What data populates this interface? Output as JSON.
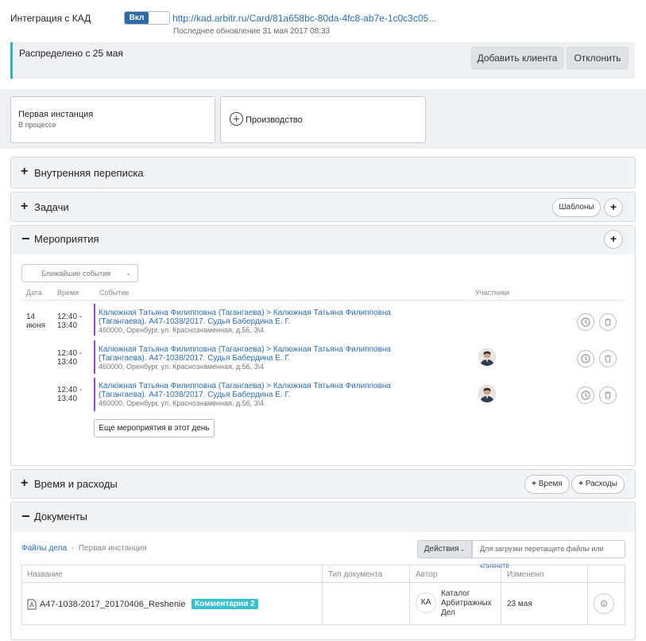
{
  "integration": {
    "title": "Интеграция с КАД",
    "toggle_label": "Вкл",
    "url": "http://kad.arbitr.ru/Card/81a658bc-80da-4fc8-ab7e-1c0c3c05...",
    "last_update": "Последнее обновление 31 мая 2017 08:33"
  },
  "distribution": {
    "text": "Распределено с 25 мая",
    "add_client_label": "Добавить клиента",
    "decline_label": "Отклонить"
  },
  "stages": {
    "first_title": "Первая инстанция",
    "first_status": "В процессе",
    "add_label": "Производство"
  },
  "sections": {
    "internal": "Внутренняя переписка",
    "tasks": "Задачи",
    "templates_label": "Шаблоны",
    "events": "Мероприятия",
    "time": "Время и расходы",
    "time_btn": "Время",
    "expenses_btn": "Расходы",
    "documents": "Документы"
  },
  "events": {
    "filter": "Ближайшие события",
    "headers": {
      "date": "Дата",
      "time": "Время",
      "event": "Событие",
      "participants": "Участники"
    },
    "date_day": "14",
    "date_month": "июня",
    "items": [
      {
        "time_start": "12:40 -",
        "time_end": "13:40",
        "line1": "Калюжная Татьяна Филипповна (Тагангаева) > Калюжная Татьяна Филипповна",
        "line2": "(Тагангаева). А47-1038/2017. Судья Бабердина Е. Г.",
        "address": "460000, Оренбург, ул. Краснознаменная, д.56, 3\\4"
      },
      {
        "time_start": "12:40 -",
        "time_end": "13:40",
        "line1": "Калюжная Татьяна Филипповна (Тагангаева) > Калюжная Татьяна Филипповна",
        "line2": "(Тагангаева). А47-1038/2017. Судья Бабердина Е. Г.",
        "address": "460000, Оренбург, ул. Краснознаменная, д.56, 3\\4"
      },
      {
        "time_start": "12:40 -",
        "time_end": "13:40",
        "line1": "Калюжная Татьяна Филипповна (Тагангаева) > Калюжная Татьяна Филипповна",
        "line2": "(Тагангаева). А47-1038/2017. Судья Бабердина Е. Г.",
        "address": "460000, Оренбург, ул. Краснознаменная, д.56, 3\\4"
      }
    ],
    "more_label": "Еще мероприятия в этот день"
  },
  "documents": {
    "breadcrumb_root": "Файлы дела",
    "breadcrumb_sep": "›",
    "breadcrumb_current": "Первая инстанция",
    "actions_label": "Действия",
    "upload_text": "Для загрузки перетащите файлы или",
    "upload_link": "кликните",
    "headers": {
      "name": "Название",
      "type": "Тип документа",
      "author": "Автор",
      "modified": "Изменено"
    },
    "row": {
      "name": "А47-1038-2017_20170406_Reshenie",
      "badge": "Комментарии 2",
      "author_initials": "КА",
      "author_line1": "Каталог",
      "author_line2": "Арбитражных",
      "author_line3": "Дел",
      "modified": "23 мая"
    }
  }
}
